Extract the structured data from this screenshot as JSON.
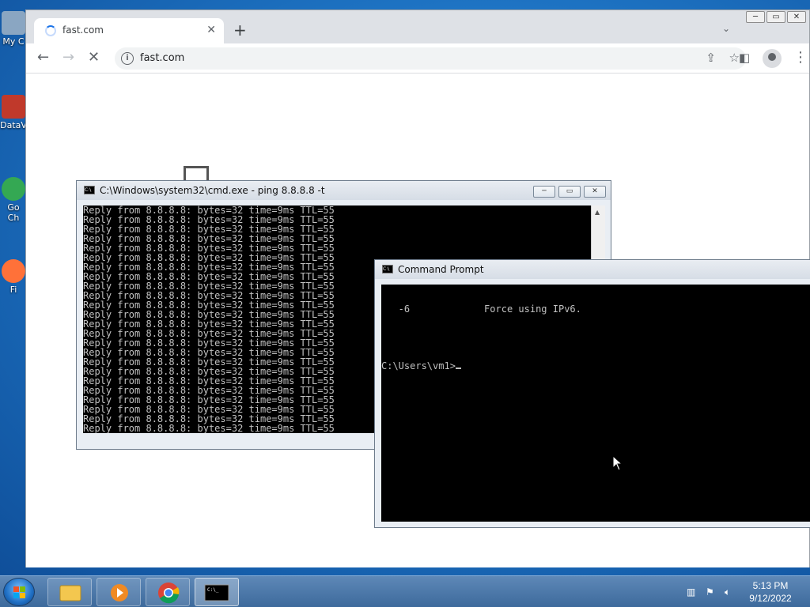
{
  "desktop": {
    "icons": [
      {
        "label": "My C",
        "color": "#6a8fb0"
      },
      {
        "label": "DataV",
        "color": "#c0392b"
      },
      {
        "label": "Go\nCh",
        "color": "#34a853"
      },
      {
        "label": "Fi",
        "color": "#ff7139"
      }
    ]
  },
  "browser": {
    "tab_title": "fast.com",
    "tab_close": "✕",
    "new_tab": "+",
    "tab_search": "⌄",
    "back": "←",
    "forward": "→",
    "stop": "✕",
    "info_glyph": "i",
    "url": "fast.com",
    "share": "⇪",
    "bookmark": "☆",
    "sidepanel": "◧",
    "menu": "⋮",
    "win_min": "─",
    "win_max": "▭",
    "win_close": "✕"
  },
  "cmd_ping": {
    "title": "C:\\Windows\\system32\\cmd.exe - ping  8.8.8.8 -t",
    "lines": [
      "Reply from 8.8.8.8: bytes=32 time=9ms TTL=55",
      "Reply from 8.8.8.8: bytes=32 time=9ms TTL=55",
      "Reply from 8.8.8.8: bytes=32 time=9ms TTL=55",
      "Reply from 8.8.8.8: bytes=32 time=9ms TTL=55",
      "Reply from 8.8.8.8: bytes=32 time=9ms TTL=55",
      "Reply from 8.8.8.8: bytes=32 time=9ms TTL=55",
      "Reply from 8.8.8.8: bytes=32 time=9ms TTL=55",
      "Reply from 8.8.8.8: bytes=32 time=9ms TTL=55",
      "Reply from 8.8.8.8: bytes=32 time=9ms TTL=55",
      "Reply from 8.8.8.8: bytes=32 time=9ms TTL=55",
      "Reply from 8.8.8.8: bytes=32 time=9ms TTL=55",
      "Reply from 8.8.8.8: bytes=32 time=9ms TTL=55",
      "Reply from 8.8.8.8: bytes=32 time=9ms TTL=55",
      "Reply from 8.8.8.8: bytes=32 time=9ms TTL=55",
      "Reply from 8.8.8.8: bytes=32 time=9ms TTL=55",
      "Reply from 8.8.8.8: bytes=32 time=9ms TTL=55",
      "Reply from 8.8.8.8: bytes=32 time=9ms TTL=55",
      "Reply from 8.8.8.8: bytes=32 time=9ms TTL=55",
      "Reply from 8.8.8.8: bytes=32 time=9ms TTL=55",
      "Reply from 8.8.8.8: bytes=32 time=9ms TTL=55",
      "Reply from 8.8.8.8: bytes=32 time=9ms TTL=55",
      "Reply from 8.8.8.8: bytes=32 time=9ms TTL=55",
      "Reply from 8.8.8.8: bytes=32 time=9ms TTL=55",
      "Reply from 8.8.8.8: bytes=32 time=9ms TTL=55"
    ]
  },
  "cmd_prompt": {
    "title": "Command Prompt",
    "line1": "   -6             Force using IPv6.",
    "prompt": "C:\\Users\\vm1>"
  },
  "taskbar": {
    "time": "5:13 PM",
    "date": "9/12/2022",
    "items": [
      "explorer",
      "media-player",
      "chrome",
      "cmd"
    ]
  }
}
